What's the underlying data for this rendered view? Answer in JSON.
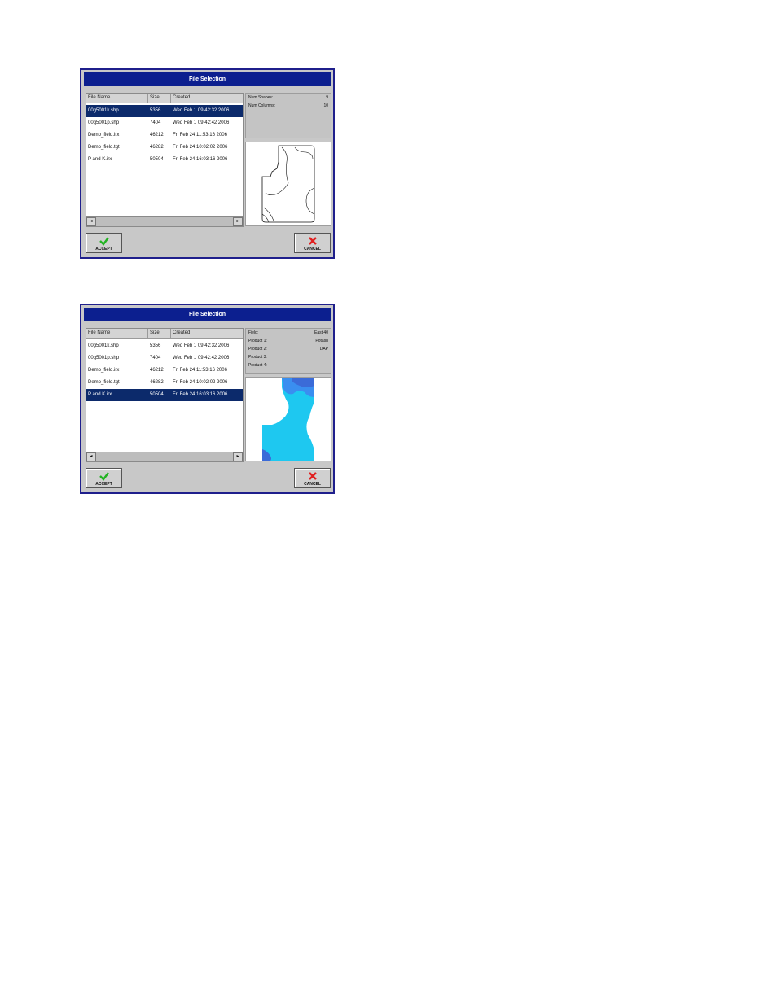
{
  "dialogs": [
    {
      "title": "File Selection",
      "columns": {
        "name": "File Name",
        "size": "Size",
        "created": "Created"
      },
      "files": [
        {
          "name": "00g5001k.shp",
          "size": "5356",
          "created": "Wed Feb 1 09:42:32 2006",
          "selected": true
        },
        {
          "name": "00g5001p.shp",
          "size": "7404",
          "created": "Wed Feb 1 09:42:42 2006",
          "selected": false
        },
        {
          "name": "Demo_field.irx",
          "size": "46212",
          "created": "Fri Feb 24 11:53:16 2006",
          "selected": false
        },
        {
          "name": "Demo_field.tgt",
          "size": "46282",
          "created": "Fri Feb 24 10:02:02 2006",
          "selected": false
        },
        {
          "name": "P and K.irx",
          "size": "50504",
          "created": "Fri Feb 24 16:03:16 2006",
          "selected": false
        }
      ],
      "info": [
        {
          "label": "Num Shapes:",
          "value": "9"
        },
        {
          "label": "Num Columns:",
          "value": "10"
        }
      ],
      "preview": {
        "type": "outline"
      },
      "accept_label": "ACCEPT",
      "cancel_label": "CANCEL"
    },
    {
      "title": "File Selection",
      "columns": {
        "name": "File Name",
        "size": "Size",
        "created": "Created"
      },
      "files": [
        {
          "name": "00g5001k.shp",
          "size": "5356",
          "created": "Wed Feb 1 09:42:32 2006",
          "selected": false
        },
        {
          "name": "00g5001p.shp",
          "size": "7404",
          "created": "Wed Feb 1 09:42:42 2006",
          "selected": false
        },
        {
          "name": "Demo_field.irx",
          "size": "46212",
          "created": "Fri Feb 24 11:53:16 2006",
          "selected": false
        },
        {
          "name": "Demo_field.tgt",
          "size": "46282",
          "created": "Fri Feb 24 10:02:02 2006",
          "selected": false
        },
        {
          "name": "P and K.irx",
          "size": "50504",
          "created": "Fri Feb 24 16:03:16 2006",
          "selected": true
        }
      ],
      "info": [
        {
          "label": "Field:",
          "value": "East 40"
        },
        {
          "label": "Product 1:",
          "value": "Potash"
        },
        {
          "label": "Product 2:",
          "value": "DAP"
        },
        {
          "label": "Product 3:",
          "value": ""
        },
        {
          "label": "Product 4:",
          "value": ""
        }
      ],
      "preview": {
        "type": "prescription-map",
        "colors": [
          "#1ec8f0",
          "#3a8ef0",
          "#3b6bd8"
        ]
      },
      "accept_label": "ACCEPT",
      "cancel_label": "CANCEL"
    }
  ],
  "scroll_left_glyph": "◂",
  "scroll_right_glyph": "▸"
}
